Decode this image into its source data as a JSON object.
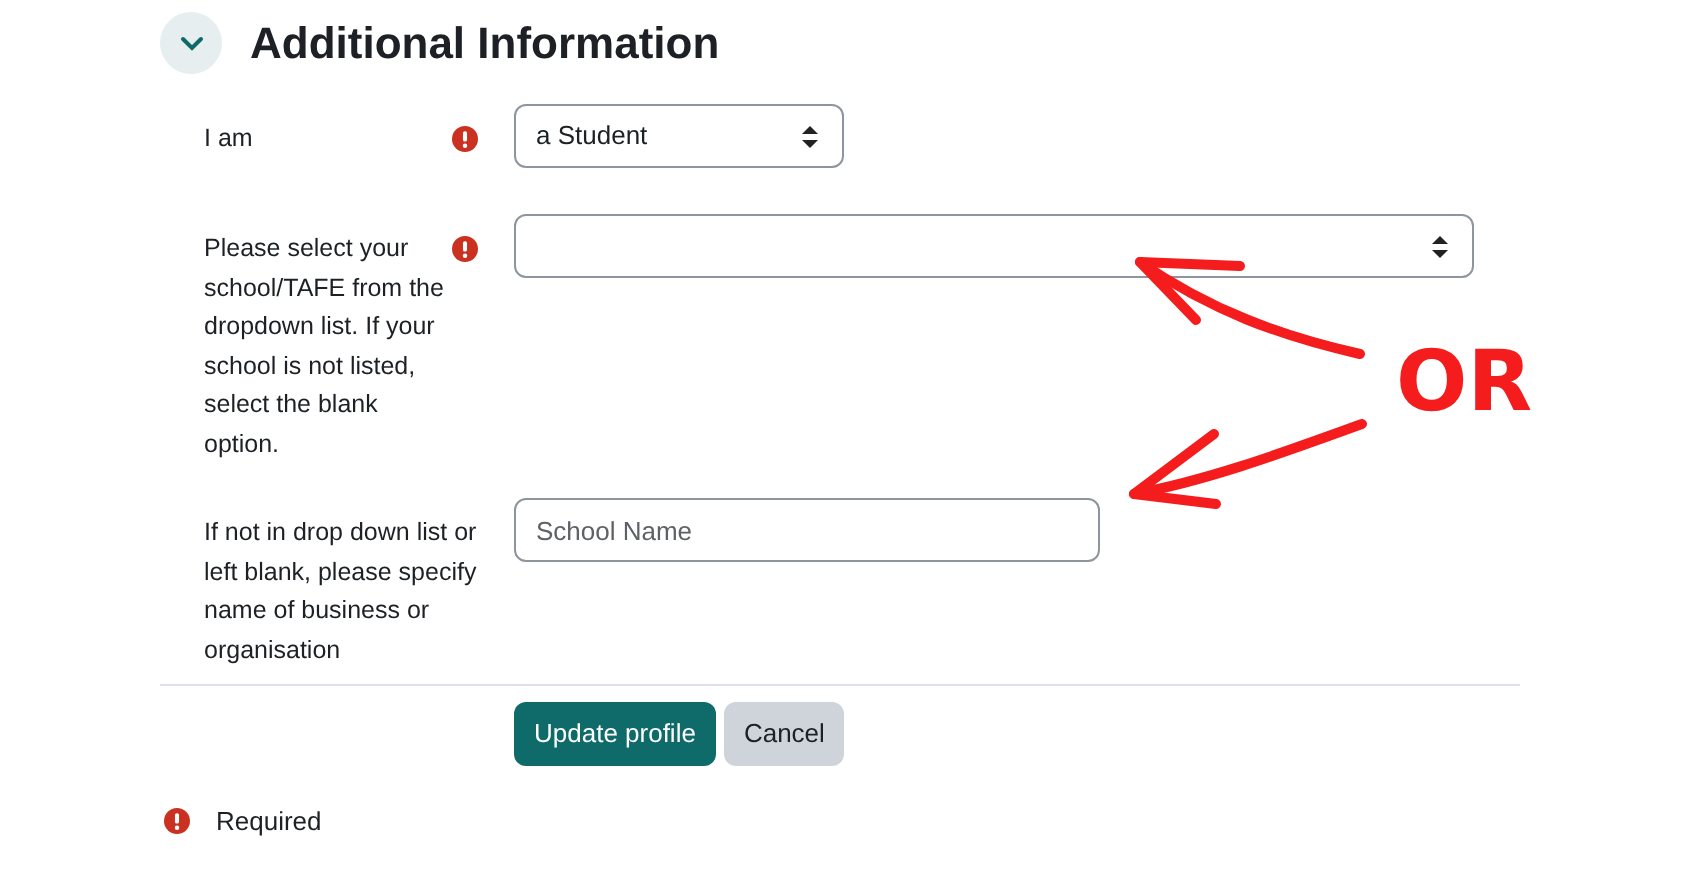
{
  "section": {
    "title": "Additional Information",
    "expanded": true
  },
  "fields": [
    {
      "kind": "select",
      "label": "I am",
      "required": true,
      "value": "a Student"
    },
    {
      "kind": "select",
      "label": "Please select your school/TAFE from the dropdown list. If your school is not listed, select the blank option.",
      "required": true
    },
    {
      "kind": "text",
      "label": "If not in drop down list or left blank, please specify name of business or organisation",
      "required": false,
      "placeholder": "School Name"
    }
  ],
  "buttons": [
    {
      "label": "Update profile",
      "kind": "primary"
    },
    {
      "label": "Cancel",
      "kind": "secondary"
    }
  ],
  "legend": {
    "label": "Required"
  },
  "annotation": {
    "text": "OR"
  }
}
